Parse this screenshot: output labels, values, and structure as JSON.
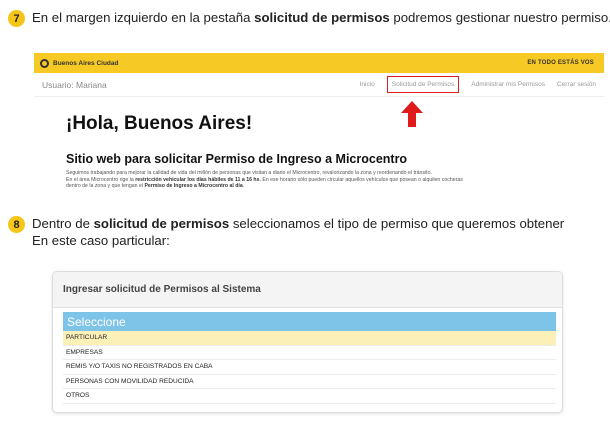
{
  "step7": {
    "number": "7",
    "text_pre": "En el margen izquierdo en la pestaña ",
    "text_bold": "solicitud de permisos",
    "text_post": " podremos gestionar nuestro permiso."
  },
  "screenshot1": {
    "brand": "Buenos Aires Ciudad",
    "tagline": "EN TODO ESTÁS VOS",
    "user": "Usuario: Mariana",
    "nav": [
      "Inicio",
      "Solicitud de Permisos",
      "Administrar mis Permisos",
      "Cerrar sesión"
    ],
    "active_nav_index": 1,
    "hello": "¡Hola, Buenos Aires!",
    "subtitle": "Sitio web para solicitar Permiso de Ingreso a Microcentro",
    "desc_line1": "Seguimos trabajando para mejorar la calidad de vida del millón de personas que visitan a diario el Microcentro, revalorizando la zona y reordenando el tránsito.",
    "desc_line2_pre": "En el área Microcentro rige la ",
    "desc_line2_bold": "restricción vehicular los días hábiles de 11 a 16 hs",
    "desc_line2_post": ". En ese horario sólo pueden circular aquellos vehículos que posean o alquilen cocheras",
    "desc_line3_pre": "dentro de la zona y que tengan el ",
    "desc_line3_bold": "Permiso de Ingreso a Microcentro al día",
    "desc_line3_post": "."
  },
  "step8": {
    "number": "8",
    "text_pre": "Dentro de ",
    "text_bold": "solicitud de permisos",
    "text_post": " seleccionamos el tipo de permiso que queremos obtener",
    "line2": "En este caso particular:"
  },
  "screenshot2": {
    "panel_title": "Ingresar solicitud de Permisos al Sistema",
    "select_header": "Seleccione",
    "options": [
      "PARTICULAR",
      "EMPRESAS",
      "REMIS Y/O TAXIS NO REGISTRADOS EN CABA",
      "PERSONAS CON MOVILIDAD REDUCIDA",
      "OTROS"
    ],
    "selected_index": 0
  },
  "colors": {
    "badge": "#f5c518",
    "topbar": "#f6c924",
    "highlight": "#e01b1b",
    "select_header": "#7ec3e8",
    "selected_row": "#faf0b8"
  }
}
